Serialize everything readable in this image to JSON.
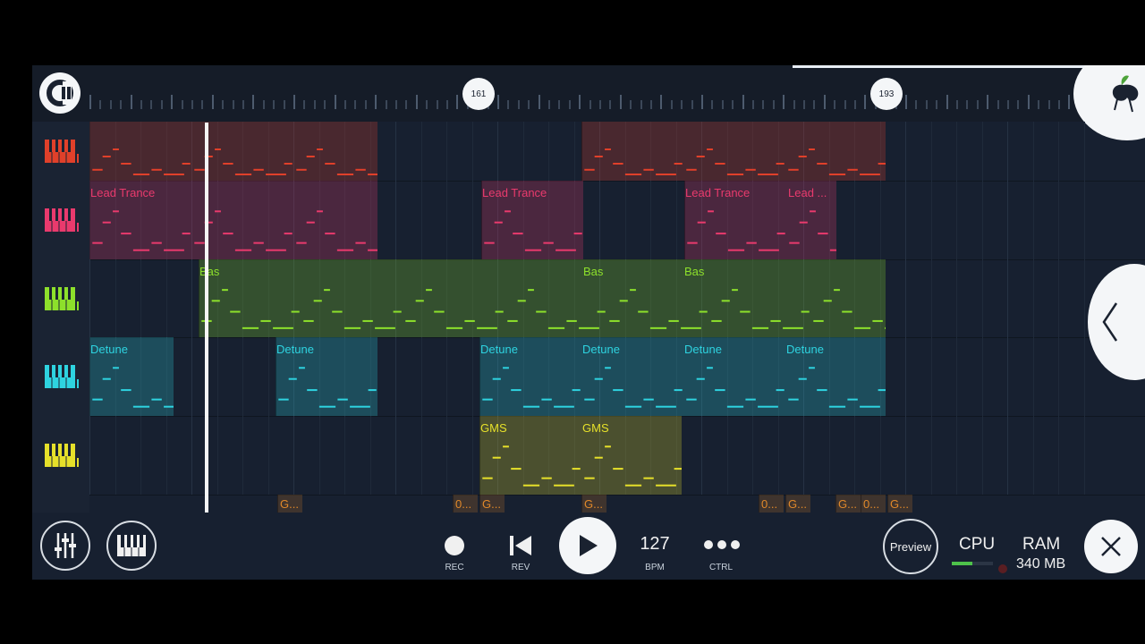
{
  "timeline": {
    "markers": [
      "161",
      "193"
    ]
  },
  "tracks": [
    {
      "color": "#e0402a",
      "clips": [
        {
          "name": ""
        },
        {
          "name": ""
        }
      ]
    },
    {
      "color": "#e93a6d",
      "clips": [
        {
          "name": "Lead Trance"
        },
        {
          "name": "Lead Trance"
        },
        {
          "name": "Lead Trance"
        },
        {
          "name": "Lead ..."
        }
      ]
    },
    {
      "color": "#8de02b",
      "clips": [
        {
          "name": "Bas"
        },
        {
          "name": "Bas"
        },
        {
          "name": "Bas"
        }
      ]
    },
    {
      "color": "#2ed3e0",
      "clips": [
        {
          "name": "Detune"
        },
        {
          "name": "Detune"
        },
        {
          "name": "Detune"
        },
        {
          "name": "Detune"
        },
        {
          "name": "Detune"
        },
        {
          "name": "Detune"
        }
      ]
    },
    {
      "color": "#e6e02a",
      "clips": [
        {
          "name": "GMS"
        },
        {
          "name": "GMS"
        }
      ]
    }
  ],
  "automation_clips": [
    "G...",
    "0...",
    "G...",
    "G...",
    "0...",
    "G...",
    "G...",
    "0...",
    "G..."
  ],
  "transport": {
    "rec_label": "REC",
    "rev_label": "REV",
    "bpm_value": "127",
    "bpm_label": "BPM",
    "ctrl_label": "CTRL",
    "preview_label": "Preview",
    "cpu_label": "CPU",
    "ram_label": "RAM",
    "ram_value": "340 MB"
  }
}
